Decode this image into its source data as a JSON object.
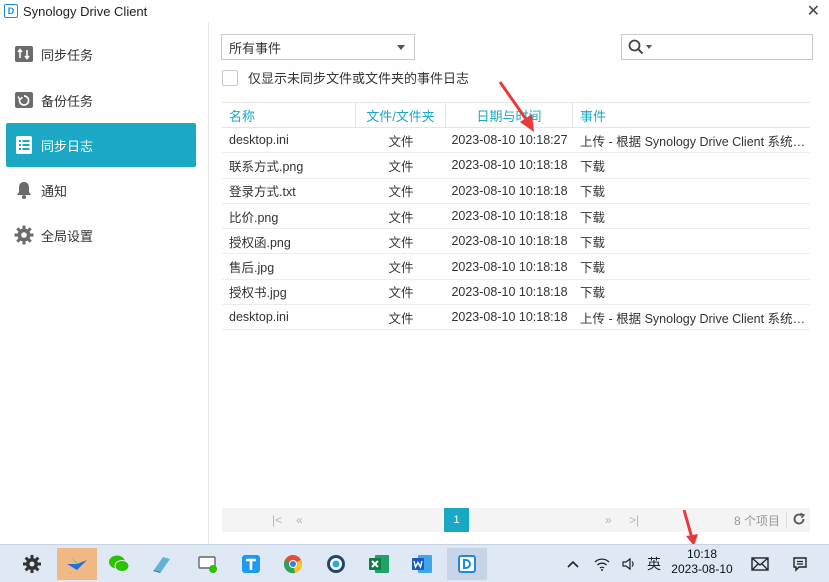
{
  "window": {
    "title": "Synology Drive Client",
    "close_glyph": "✕"
  },
  "sidebar": {
    "items": [
      {
        "label": "同步任务",
        "icon": "sync-arrows-icon",
        "active": false
      },
      {
        "label": "备份任务",
        "icon": "backup-restore-icon",
        "active": false
      },
      {
        "label": "同步日志",
        "icon": "log-list-icon",
        "active": true
      },
      {
        "label": "通知",
        "icon": "bell-icon",
        "active": false
      },
      {
        "label": "全局设置",
        "icon": "gear-icon",
        "active": false
      }
    ]
  },
  "filter": {
    "selected": "所有事件"
  },
  "search": {
    "placeholder": ""
  },
  "only_unsynced": {
    "label": "仅显示未同步文件或文件夹的事件日志",
    "checked": false
  },
  "table": {
    "columns": [
      "名称",
      "文件/文件夹",
      "日期与时间",
      "事件"
    ],
    "rows": [
      {
        "name": "desktop.ini",
        "type": "文件",
        "datetime": "2023-08-10 10:18:27",
        "event": "上传 - 根据 Synology Drive Client 系统规则..."
      },
      {
        "name": "联系方式.png",
        "type": "文件",
        "datetime": "2023-08-10 10:18:18",
        "event": "下载"
      },
      {
        "name": "登录方式.txt",
        "type": "文件",
        "datetime": "2023-08-10 10:18:18",
        "event": "下载"
      },
      {
        "name": "比价.png",
        "type": "文件",
        "datetime": "2023-08-10 10:18:18",
        "event": "下载"
      },
      {
        "name": "授权函.png",
        "type": "文件",
        "datetime": "2023-08-10 10:18:18",
        "event": "下载"
      },
      {
        "name": "售后.jpg",
        "type": "文件",
        "datetime": "2023-08-10 10:18:18",
        "event": "下载"
      },
      {
        "name": "授权书.jpg",
        "type": "文件",
        "datetime": "2023-08-10 10:18:18",
        "event": "下载"
      },
      {
        "name": "desktop.ini",
        "type": "文件",
        "datetime": "2023-08-10 10:18:18",
        "event": "上传 - 根据 Synology Drive Client 系统规则..."
      }
    ]
  },
  "pager": {
    "current": "1",
    "count_text": "8 个项目",
    "first": "|<",
    "prev": "«",
    "next": "»",
    "last": ">|"
  },
  "taskbar": {
    "apps": [
      "settings-gear-icon",
      "lark-icon",
      "wechat-icon",
      "notes-icon",
      "remote-desktop-icon",
      "tick-app-icon",
      "chrome-icon",
      "browser-icon",
      "excel-icon",
      "word-icon",
      "synology-drive-icon"
    ],
    "ime": "英",
    "time": "10:18",
    "date": "2023-08-10"
  },
  "colors": {
    "accent": "#1aa8c5",
    "arrow": "#e83a3a"
  }
}
